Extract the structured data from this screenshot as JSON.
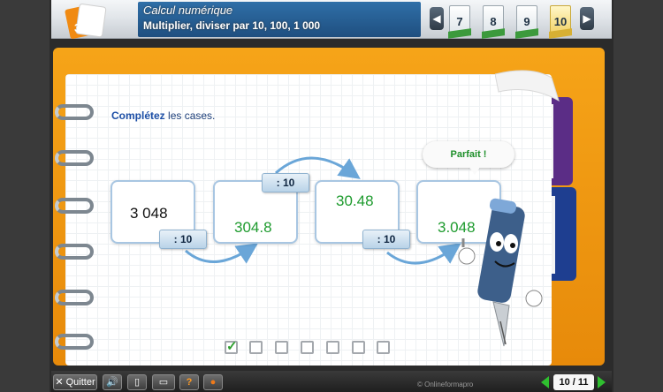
{
  "header": {
    "subject": "Calcul numérique",
    "lesson_title": "Multiplier, diviser par 10, 100, 1 000",
    "prev_icon": "chevron-left-icon",
    "next_icon": "chevron-right-icon",
    "pages": [
      {
        "label": "7"
      },
      {
        "label": "8"
      },
      {
        "label": "9"
      },
      {
        "label": "10",
        "active": true
      }
    ]
  },
  "exercise": {
    "instruction_bold": "Complétez",
    "instruction_rest": " les cases.",
    "boxes": [
      {
        "value": "3 048"
      },
      {
        "value": "304.8"
      },
      {
        "value": "30.48"
      },
      {
        "value": "3.048"
      }
    ],
    "operations": [
      {
        "label": ": 10"
      },
      {
        "label": ": 10"
      },
      {
        "label": ": 10"
      }
    ],
    "feedback": "Parfait !",
    "progress": {
      "total": 7,
      "completed": 1
    }
  },
  "footer": {
    "quit_label": "Quitter",
    "buttons": [
      "speaker-icon",
      "document-icon",
      "book-icon",
      "help-icon",
      "record-icon"
    ],
    "copyright": "© Onlineformapro",
    "page_indicator": "10 / 11"
  },
  "colors": {
    "notebook_orange": "#f39c12",
    "answer_green": "#1e9b2e",
    "header_blue": "#1f4f80"
  }
}
